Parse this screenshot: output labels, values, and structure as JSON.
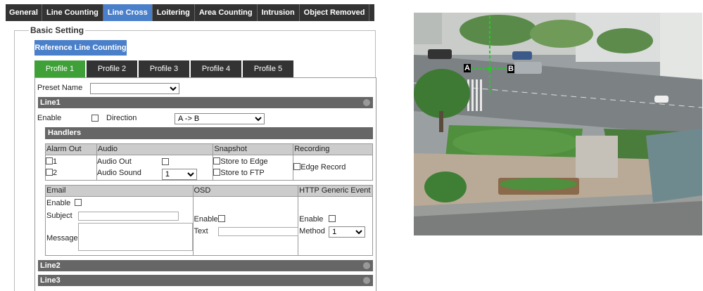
{
  "top_tabs": [
    "General",
    "Line Counting",
    "Line Cross",
    "Loitering",
    "Area Counting",
    "Intrusion",
    "Object Removed"
  ],
  "active_top_tab": "Line Cross",
  "basic_setting": {
    "legend": "Basic Setting",
    "reference_button": "Reference Line Counting"
  },
  "profile_tabs": [
    "Profile 1",
    "Profile 2",
    "Profile 3",
    "Profile 4",
    "Profile 5"
  ],
  "active_profile": "Profile 1",
  "preset": {
    "label": "Preset Name",
    "value": ""
  },
  "line1": {
    "title": "Line1",
    "enable_label": "Enable",
    "direction_label": "Direction",
    "direction_value": "A -> B",
    "handlers_title": "Handlers",
    "alarm_out": {
      "header": "Alarm Out",
      "items": [
        "1",
        "2"
      ]
    },
    "audio": {
      "header": "Audio",
      "audio_out_label": "Audio Out",
      "audio_sound_label": "Audio Sound",
      "audio_sound_value": "1"
    },
    "snapshot": {
      "header": "Snapshot",
      "items": [
        "Store to Edge",
        "Store to FTP"
      ]
    },
    "recording": {
      "header": "Recording",
      "edge_record": "Edge Record"
    },
    "email": {
      "header": "Email",
      "enable_label": "Enable",
      "subject_label": "Subject",
      "message_label": "Message"
    },
    "osd": {
      "header": "OSD",
      "enable_label": "Enable",
      "text_label": "Text"
    },
    "http": {
      "header": "HTTP Generic Event",
      "enable_label": "Enable",
      "method_label": "Method",
      "method_value": "1"
    }
  },
  "line2": {
    "title": "Line2"
  },
  "line3": {
    "title": "Line3"
  },
  "camera": {
    "point_a": "A",
    "point_b": "B",
    "line_color": "#22cc22"
  },
  "colors": {
    "active_tab": "#4a7fc9",
    "active_profile": "#3ea037",
    "bar": "#666666"
  }
}
